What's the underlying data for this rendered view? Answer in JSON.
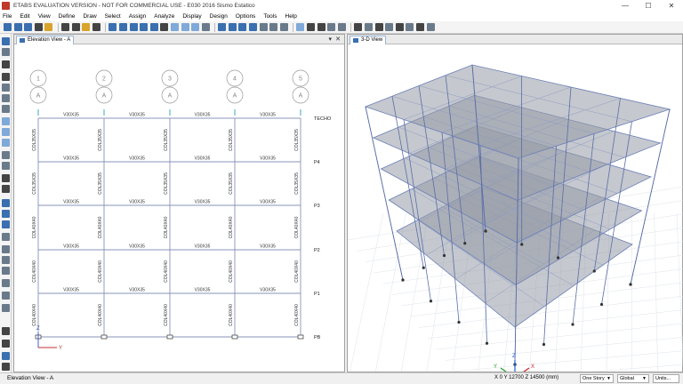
{
  "window": {
    "title": "ETABS EVALUATION VERSION - NOT FOR COMMERCIAL USE - E030 2016 Sismo Estatico",
    "min": "—",
    "max": "☐",
    "close": "✕"
  },
  "menu": [
    "File",
    "Edit",
    "View",
    "Define",
    "Draw",
    "Select",
    "Assign",
    "Analyze",
    "Display",
    "Design",
    "Options",
    "Tools",
    "Help"
  ],
  "elevation_view": {
    "tab_label": "Elevation View - A",
    "grid_ids": [
      "1",
      "2",
      "3",
      "4",
      "5"
    ],
    "grid_line_label": "A",
    "story_labels": [
      "TECHO",
      "P4",
      "P3",
      "P2",
      "P1",
      "PB"
    ],
    "beam_labels_row": [
      [
        "V30X35",
        "V30X35",
        "V30X35",
        "V30X35"
      ],
      [
        "V30X35",
        "V30X35",
        "V30X35",
        "V30X35"
      ],
      [
        "V30X35",
        "V30X35",
        "V30X35",
        "V30X35"
      ],
      [
        "V30X35",
        "V30X35",
        "V30X35",
        "V30X35"
      ],
      [
        "V30X35",
        "V30X35",
        "V30X35",
        "V30X35"
      ]
    ],
    "column_labels_row": [
      [
        "COL35X35",
        "COL35X35",
        "COL35X35",
        "COL35X35",
        "COL35X35"
      ],
      [
        "COL35X35",
        "COL35X35",
        "COL35X35",
        "COL35X35",
        "COL35X35"
      ],
      [
        "COL40X40",
        "COL40X40",
        "COL40X40",
        "COL40X40",
        "COL40X40"
      ],
      [
        "COL40X40",
        "COL40X40",
        "COL40X40",
        "COL40X40",
        "COL40X40"
      ],
      [
        "COL40X40",
        "COL40X40",
        "COL40X40",
        "COL40X40",
        "COL40X40"
      ]
    ],
    "axis_x": "Z",
    "axis_y": "Y"
  },
  "three_d_view": {
    "tab_label": "3-D View",
    "axis_x": "X",
    "axis_y": "Y",
    "axis_z": "Z"
  },
  "status": {
    "text": "Elevation View - A",
    "coords": "X 0  Y 12700  Z 14500 (mm)",
    "story_select": "One Story",
    "coord_system": "Global",
    "units": "Units..."
  }
}
